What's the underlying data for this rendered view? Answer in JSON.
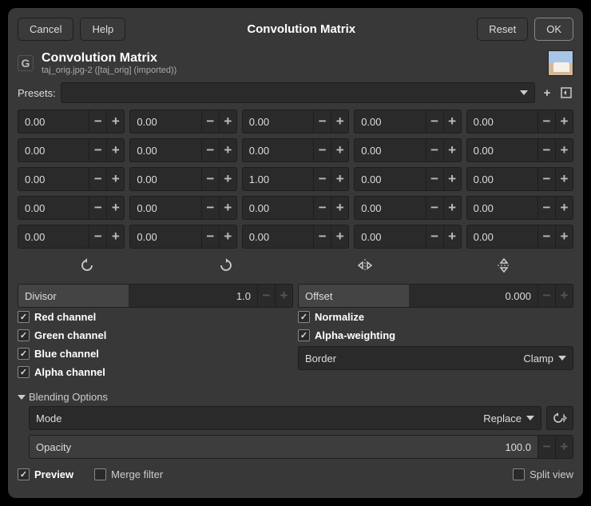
{
  "buttons": {
    "cancel": "Cancel",
    "help": "Help",
    "reset": "Reset",
    "ok": "OK"
  },
  "title": "Convolution Matrix",
  "dialog": {
    "title": "Convolution Matrix",
    "subtitle": "taj_orig.jpg-2 ([taj_orig] (imported))"
  },
  "presets_label": "Presets:",
  "matrix": [
    [
      "0.00",
      "0.00",
      "0.00",
      "0.00",
      "0.00"
    ],
    [
      "0.00",
      "0.00",
      "0.00",
      "0.00",
      "0.00"
    ],
    [
      "0.00",
      "0.00",
      "1.00",
      "0.00",
      "0.00"
    ],
    [
      "0.00",
      "0.00",
      "0.00",
      "0.00",
      "0.00"
    ],
    [
      "0.00",
      "0.00",
      "0.00",
      "0.00",
      "0.00"
    ]
  ],
  "divisor": {
    "label": "Divisor",
    "value": "1.0"
  },
  "offset": {
    "label": "Offset",
    "value": "0.000"
  },
  "channels": {
    "red": "Red channel",
    "green": "Green channel",
    "blue": "Blue channel",
    "alpha": "Alpha channel"
  },
  "options": {
    "normalize": "Normalize",
    "alpha_weighting": "Alpha-weighting"
  },
  "border": {
    "label": "Border",
    "value": "Clamp"
  },
  "blending": {
    "header": "Blending Options",
    "mode_label": "Mode",
    "mode_value": "Replace",
    "opacity_label": "Opacity",
    "opacity_value": "100.0"
  },
  "footer": {
    "preview": "Preview",
    "merge": "Merge filter",
    "split": "Split view"
  }
}
